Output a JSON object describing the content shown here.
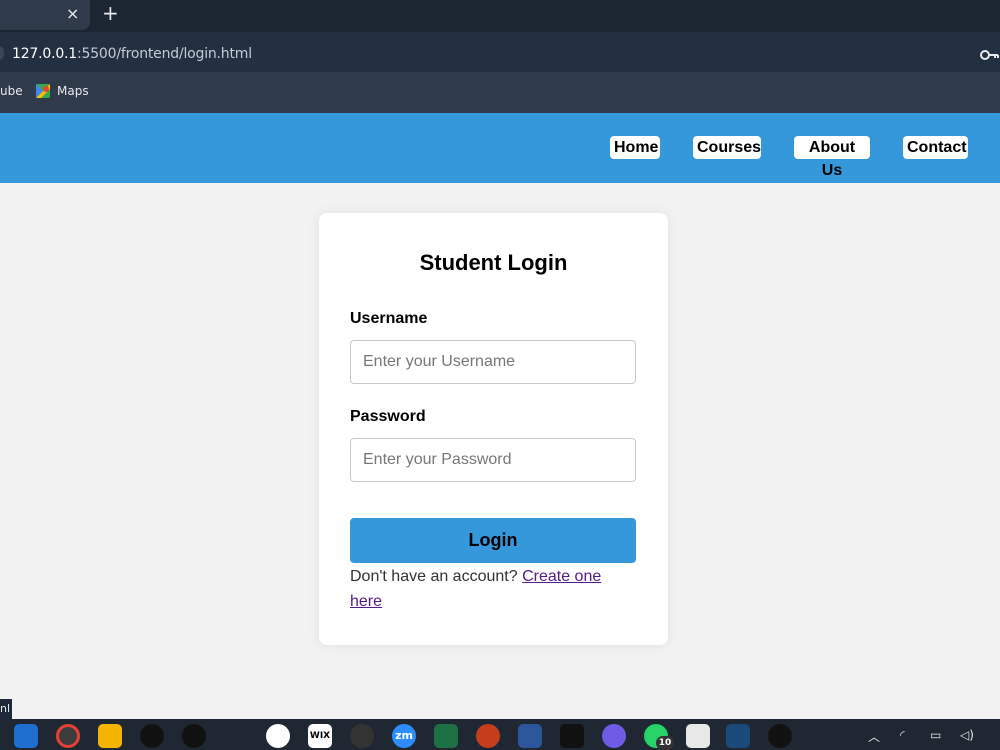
{
  "browser": {
    "tab_close": "×",
    "new_tab": "+",
    "url_host": "127.0.0.1",
    "url_path": ":5500/frontend/login.html",
    "bookmarks": [
      "ube",
      "Maps"
    ]
  },
  "nav": {
    "links": [
      "Home",
      "Courses",
      "About Us",
      "Contact"
    ]
  },
  "login": {
    "title": "Student Login",
    "username_label": "Username",
    "username_placeholder": "Enter your Username",
    "password_label": "Password",
    "password_placeholder": "Enter your Password",
    "button_label": "Login",
    "signup_prompt": "Don't have an account?",
    "signup_link": "Create one here"
  },
  "status_tip": "nl",
  "taskbar": {
    "badge": "10",
    "wix": "WIX",
    "zoom": "zm"
  },
  "colors": {
    "header": "#3498db",
    "button": "#3498db",
    "page_bg": "#f2f2f2"
  }
}
